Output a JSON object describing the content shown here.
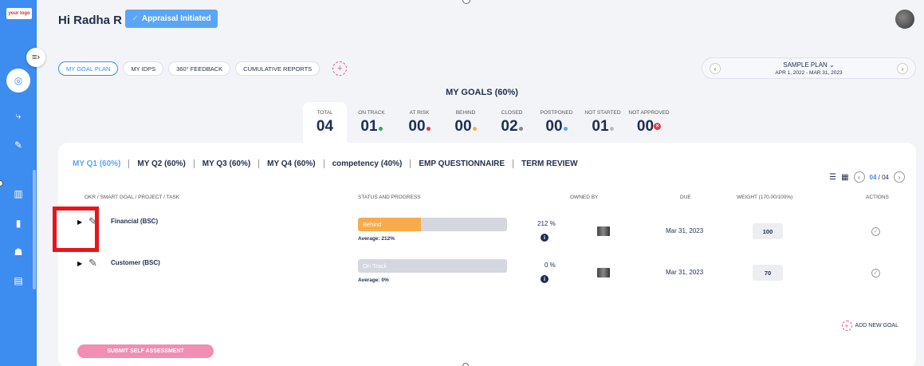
{
  "sidebar": {
    "logo": "your logo",
    "icons": [
      "collapse-icon",
      "goals-icon",
      "hierarchy-icon",
      "edit-icon",
      "chart-icon",
      "book-icon",
      "team-icon",
      "report-icon"
    ]
  },
  "header": {
    "greeting": "Hi Radha R",
    "status_button": "Appraisal Initiated"
  },
  "tabs": [
    {
      "label": "MY GOAL PLAN",
      "active": true
    },
    {
      "label": "MY IDPS",
      "active": false
    },
    {
      "label": "360° FEEDBACK",
      "active": false
    },
    {
      "label": "CUMULATIVE REPORTS",
      "active": false
    }
  ],
  "plan": {
    "name": "SAMPLE PLAN",
    "dates": "APR 1, 2022 - MAR 31, 2023"
  },
  "goals": {
    "title": "MY GOALS (60%)",
    "stats": [
      {
        "label": "TOTAL",
        "value": "04"
      },
      {
        "label": "ON TRACK",
        "value": "01",
        "dot_color": "#27ae60"
      },
      {
        "label": "AT RISK",
        "value": "00",
        "dot_color": "#e0394a"
      },
      {
        "label": "BEHIND",
        "value": "00",
        "dot_color": "#f8ab4a"
      },
      {
        "label": "CLOSED",
        "value": "02",
        "dot_color": "#888888"
      },
      {
        "label": "POSTPONED",
        "value": "00",
        "dot_color": "#5aa5f5"
      },
      {
        "label": "NOT STARTED",
        "value": "01",
        "dot_color": "#bbbbbb"
      },
      {
        "label": "NOT APPROVED",
        "value": "00",
        "dot_color": "#e0394a"
      }
    ]
  },
  "quarter_tabs": [
    {
      "label": "MY Q1 (60%)",
      "active": true
    },
    {
      "label": "MY Q2 (60%)",
      "active": false
    },
    {
      "label": "MY Q3 (60%)",
      "active": false
    },
    {
      "label": "MY Q4 (60%)",
      "active": false
    },
    {
      "label": "competency (40%)",
      "active": false
    },
    {
      "label": "EMP QUESTIONNAIRE",
      "active": false
    },
    {
      "label": "TERM REVIEW",
      "active": false
    }
  ],
  "pager": {
    "current": "04",
    "total": "/ 04"
  },
  "table": {
    "headers": {
      "goal": "OKR / SMART GOAL / PROJECT / TASK",
      "status": "STATUS AND PROGRESS",
      "owner": "OWNED BY",
      "due": "DUE",
      "weight": "WEIGHT (170.00/100%)",
      "actions": "ACTIONS"
    },
    "rows": [
      {
        "name": "Financial (BSC)",
        "status": "Behind",
        "progress": 0.42,
        "average": "Average: 212%",
        "pct": "212  %",
        "due": "Mar 31, 2023",
        "weight": "100"
      },
      {
        "name": "Customer (BSC)",
        "status": "On Track",
        "progress": 0,
        "average": "Average: 0%",
        "pct": "0  %",
        "due": "Mar 31, 2023",
        "weight": "70"
      }
    ]
  },
  "add_goal": "ADD NEW GOAL",
  "submit": "SUBMIT SELF ASSESSMENT",
  "colors": {
    "accent": "#3d8cf0",
    "behind": "#f8ab4a",
    "submit": "#f28db3",
    "highlight": "#e8141a"
  }
}
